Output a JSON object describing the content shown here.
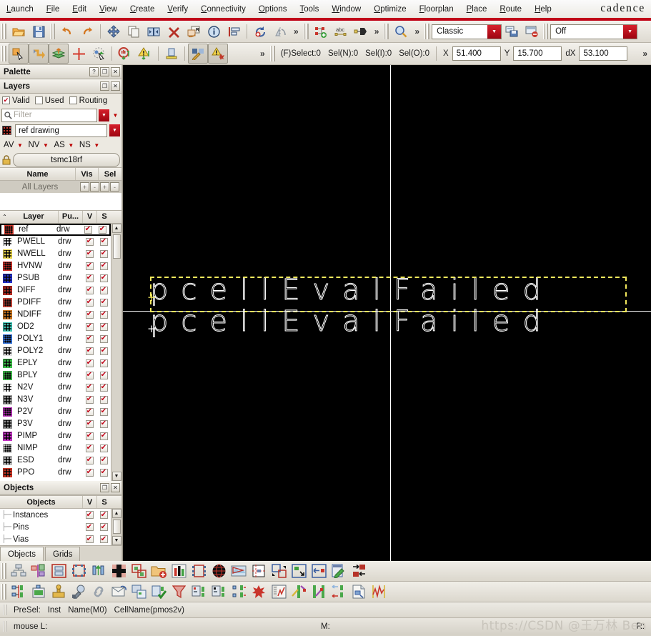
{
  "menu": {
    "items": [
      "Launch",
      "File",
      "Edit",
      "View",
      "Create",
      "Verify",
      "Connectivity",
      "Options",
      "Tools",
      "Window",
      "Optimize",
      "Floorplan",
      "Place",
      "Route",
      "Help"
    ],
    "brand": "cadence"
  },
  "toolbar1": {
    "icons": [
      "open-folder-icon",
      "save-icon",
      "undo-icon",
      "redo-icon",
      "move-icon",
      "copy-icon",
      "stretch-icon",
      "delete-icon",
      "replace-icon",
      "info-icon",
      "align-icon",
      "update-icon",
      "mirror-icon"
    ],
    "more_label": "»",
    "icons2": [
      "create-net-icon",
      "abc-label-icon",
      "create-pin-icon"
    ],
    "more_label2": "»",
    "zoom_icon": "zoom-icon",
    "more_label3": "»",
    "view_combo": "Classic",
    "save_view_icon": "save-view-icon",
    "delete-view-icon": "delete-view-icon",
    "snap_combo": "Off"
  },
  "toolbar2": {
    "icons": [
      "select-cursor-icon",
      "wire-route-icon",
      "layer-stack-icon",
      "crosshair-icon",
      "select-area-icon",
      "stop-push-icon",
      "warn-push-icon",
      "ruler-icon",
      "edit-pin-icon",
      "drc-error-icon"
    ],
    "more_label": "»",
    "select_f": "(F)Select:0",
    "sel_n": "Sel(N):0",
    "sel_i": "Sel(I):0",
    "sel_o": "Sel(O):0",
    "x_label": "X",
    "x_value": "51.400",
    "y_label": "Y",
    "y_value": "15.700",
    "dx_label": "dX",
    "dx_value": "53.100",
    "more_label2": "»"
  },
  "palette": {
    "title": "Palette",
    "help_btn": "?",
    "restore_btn": "❐",
    "close_btn": "✕"
  },
  "layers_panel": {
    "title": "Layers",
    "restore_btn": "❐",
    "close_btn": "✕",
    "filters": [
      {
        "label": "Valid",
        "checked": true
      },
      {
        "label": "Used",
        "checked": false
      },
      {
        "label": "Routing",
        "checked": false
      }
    ],
    "filter_placeholder": "Filter",
    "search_icon": "search-icon",
    "lpv_value": "ref drawing",
    "lpv_swatch": "#c8382f",
    "av_menus": [
      "AV",
      "NV",
      "AS",
      "NS"
    ],
    "tech_lib": "tsmc18rf",
    "lock_icon": "lock-icon",
    "name_header": "Name",
    "vis_header": "Vis",
    "sel_header": "Sel",
    "all_layers_label": "All Layers",
    "all_layers_buttons": [
      "+",
      "-",
      "+",
      "-"
    ],
    "table_headers": [
      "Layer",
      "Pu...",
      "V",
      "S"
    ],
    "rows": [
      {
        "name": "ref",
        "purpose": "drw",
        "v": true,
        "s": true,
        "color": "#d43a2c",
        "selected": true
      },
      {
        "name": "PWELL",
        "purpose": "drw",
        "v": true,
        "s": true,
        "color": "#ffffff",
        "selected": false
      },
      {
        "name": "NWELL",
        "purpose": "drw",
        "v": true,
        "s": true,
        "color": "#e8d44b",
        "selected": false
      },
      {
        "name": "HVNW",
        "purpose": "drw",
        "v": true,
        "s": true,
        "color": "#cf2a24",
        "selected": false
      },
      {
        "name": "PSUB",
        "purpose": "drw",
        "v": true,
        "s": true,
        "color": "#2230c8",
        "selected": false
      },
      {
        "name": "DIFF",
        "purpose": "drw",
        "v": true,
        "s": true,
        "color": "#b42a22",
        "selected": false
      },
      {
        "name": "PDIFF",
        "purpose": "drw",
        "v": true,
        "s": true,
        "color": "#d4473a",
        "selected": false
      },
      {
        "name": "NDIFF",
        "purpose": "drw",
        "v": true,
        "s": true,
        "color": "#c8741e",
        "selected": false
      },
      {
        "name": "OD2",
        "purpose": "drw",
        "v": true,
        "s": true,
        "color": "#3fc4b6",
        "selected": false
      },
      {
        "name": "POLY1",
        "purpose": "drw",
        "v": true,
        "s": true,
        "color": "#2f6fd8",
        "selected": false
      },
      {
        "name": "POLY2",
        "purpose": "drw",
        "v": true,
        "s": true,
        "color": "#dddddd",
        "selected": false
      },
      {
        "name": "EPLY",
        "purpose": "drw",
        "v": true,
        "s": true,
        "color": "#3cc24a",
        "selected": false
      },
      {
        "name": "BPLY",
        "purpose": "drw",
        "v": true,
        "s": true,
        "color": "#3cc24a",
        "selected": false
      },
      {
        "name": "N2V",
        "purpose": "drw",
        "v": true,
        "s": true,
        "color": "#ffffff",
        "selected": false
      },
      {
        "name": "N3V",
        "purpose": "drw",
        "v": true,
        "s": true,
        "color": "#9a9a9a",
        "selected": false
      },
      {
        "name": "P2V",
        "purpose": "drw",
        "v": true,
        "s": true,
        "color": "#b52bb5",
        "selected": false
      },
      {
        "name": "P3V",
        "purpose": "drw",
        "v": true,
        "s": true,
        "color": "#8f8f8f",
        "selected": false
      },
      {
        "name": "PIMP",
        "purpose": "drw",
        "v": true,
        "s": true,
        "color": "#c22ec2",
        "selected": false
      },
      {
        "name": "NIMP",
        "purpose": "drw",
        "v": true,
        "s": true,
        "color": "#dddddd",
        "selected": false
      },
      {
        "name": "ESD",
        "purpose": "drw",
        "v": true,
        "s": true,
        "color": "#bbbbbb",
        "selected": false
      },
      {
        "name": "PPO",
        "purpose": "drw",
        "v": true,
        "s": true,
        "color": "#cc3322",
        "selected": false
      }
    ]
  },
  "objects_panel": {
    "title": "Objects",
    "restore_btn": "❐",
    "close_btn": "✕",
    "header": "Objects",
    "vis_header": "V",
    "sel_header": "S",
    "rows": [
      {
        "name": "Instances",
        "v": true,
        "s": true
      },
      {
        "name": "Pins",
        "v": true,
        "s": true
      },
      {
        "name": "Vias",
        "v": true,
        "s": true
      }
    ],
    "tabs": [
      {
        "label": "Objects",
        "active": true
      },
      {
        "label": "Grids",
        "active": false
      }
    ]
  },
  "canvas": {
    "background": "#000000",
    "text_top": "pcellEvalFailed",
    "text_bottom": "pcellEvalFailed",
    "selection_color": "#f2e85c",
    "line_color": "#ffffff",
    "origin_mark": "+"
  },
  "bottom_toolbar_1": {
    "icons": [
      "hierarchy-icon",
      "partition-icon",
      "group-icon",
      "chip-io-icon",
      "pin-updown-icon",
      "macro-place-icon",
      "module-icon",
      "open-design-icon",
      "bargraph-icon",
      "flexible-block-icon",
      "globe-icon",
      "preview-icon",
      "guide-icon",
      "move-block-icon",
      "resize-block-icon",
      "align-block-icon",
      "edit-boundary-icon",
      "swap-icon"
    ]
  },
  "bottom_toolbar_2": {
    "icons": [
      "pin-editor-icon",
      "pin-table-icon",
      "power-plan-icon",
      "pin-probe-icon",
      "link-icon",
      "mail-icon",
      "copy-pin-icon",
      "check-pin-icon",
      "funnel-icon",
      "pin-group-icon",
      "pin-group2-icon",
      "pin-align-icon",
      "explode-icon",
      "waveform-table-icon",
      "route-pin-icon",
      "route-diag-icon",
      "spread-pin-icon",
      "report-icon",
      "analysis-icon"
    ]
  },
  "statusbar": {
    "presel_label": "PreSel:",
    "inst": "Inst",
    "name": "Name(M0)",
    "cellname": "CellName(pmos2v)"
  },
  "msgbar": {
    "mouse_l": "mouse L:",
    "mouse_m": "M:",
    "mouse_r": "R:",
    "watermark": "https://CSDN @王万林 Ben"
  }
}
